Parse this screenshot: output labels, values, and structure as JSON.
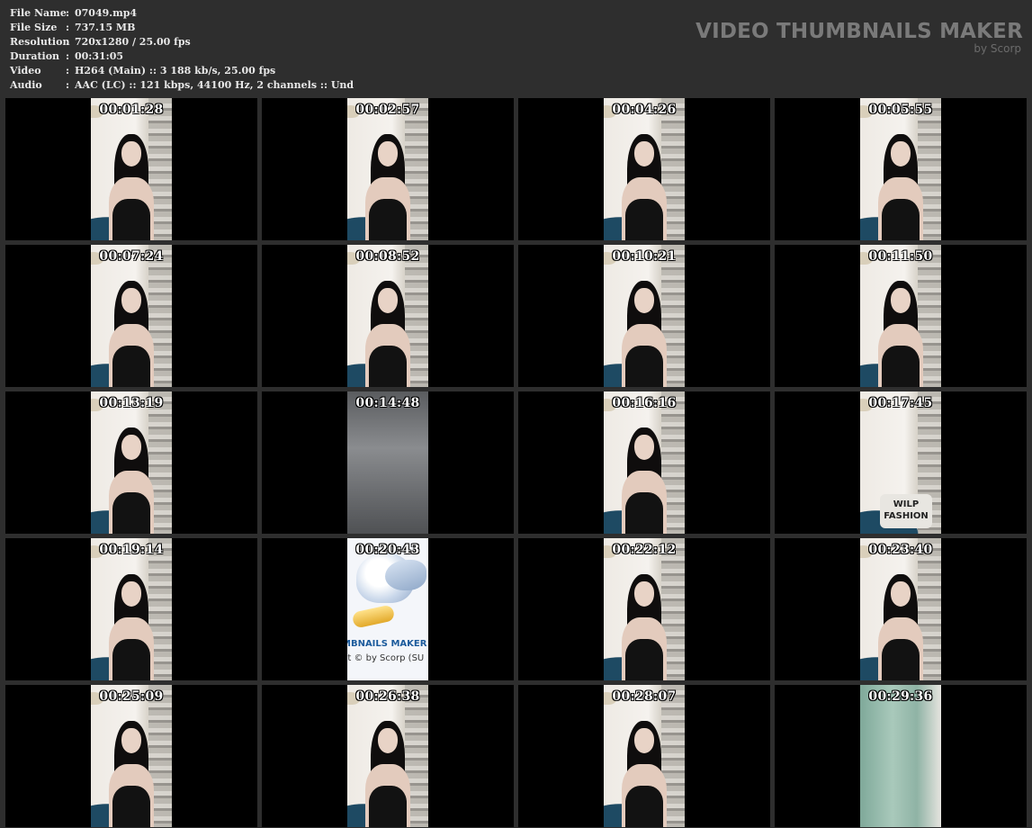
{
  "info": [
    {
      "label": "File Name",
      "sep": ":",
      "value": "07049.mp4"
    },
    {
      "label": "File Size",
      "sep": ":",
      "value": "737.15 MB"
    },
    {
      "label": "Resolution",
      "sep": ":",
      "value": "720x1280 / 25.00 fps"
    },
    {
      "label": "Duration",
      "sep": ":",
      "value": "00:31:05"
    },
    {
      "label": "Video",
      "sep": ":",
      "value": "H264 (Main) :: 3 188 kb/s, 25.00 fps"
    },
    {
      "label": "Audio",
      "sep": ":",
      "value": "AAC (LC) :: 121 kbps, 44100 Hz, 2 channels :: Und"
    }
  ],
  "brand": {
    "title": "VIDEO THUMBNAILS MAKER",
    "subtitle": "by Scorp"
  },
  "thumbnails": [
    {
      "time": "00:01:28",
      "kind": "room"
    },
    {
      "time": "00:02:57",
      "kind": "room"
    },
    {
      "time": "00:04:26",
      "kind": "room"
    },
    {
      "time": "00:05:55",
      "kind": "room"
    },
    {
      "time": "00:07:24",
      "kind": "room"
    },
    {
      "time": "00:08:52",
      "kind": "room"
    },
    {
      "time": "00:10:21",
      "kind": "room"
    },
    {
      "time": "00:11:50",
      "kind": "room"
    },
    {
      "time": "00:13:19",
      "kind": "room"
    },
    {
      "time": "00:14:48",
      "kind": "gray"
    },
    {
      "time": "00:16:16",
      "kind": "room"
    },
    {
      "time": "00:17:45",
      "kind": "pillow",
      "pillow_text": "WILP FASHION"
    },
    {
      "time": "00:19:14",
      "kind": "room"
    },
    {
      "time": "00:20:43",
      "kind": "logo",
      "logo_line1": "MBNAILS MAKER 8",
      "logo_line2": "nt © by Scorp (SU"
    },
    {
      "time": "00:22:12",
      "kind": "room"
    },
    {
      "time": "00:23:40",
      "kind": "room"
    },
    {
      "time": "00:25:09",
      "kind": "room"
    },
    {
      "time": "00:26:38",
      "kind": "room"
    },
    {
      "time": "00:28:07",
      "kind": "room"
    },
    {
      "time": "00:29:36",
      "kind": "green"
    }
  ]
}
